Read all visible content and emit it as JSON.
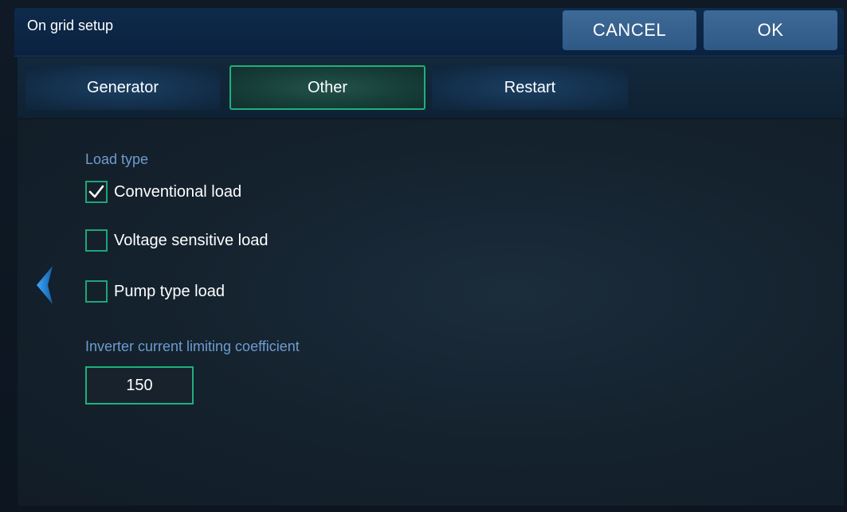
{
  "header": {
    "title": "On grid setup",
    "cancel_label": "CANCEL",
    "ok_label": "OK"
  },
  "tabs": [
    {
      "label": "Generator",
      "active": false
    },
    {
      "label": "Other",
      "active": true
    },
    {
      "label": "Restart",
      "active": false
    }
  ],
  "load_type": {
    "label": "Load type",
    "options": [
      {
        "label": "Conventional load",
        "checked": true
      },
      {
        "label": "Voltage sensitive load",
        "checked": false
      },
      {
        "label": "Pump type load",
        "checked": false
      }
    ]
  },
  "inverter": {
    "label": "Inverter current limiting coefficient",
    "value": "150"
  },
  "colors": {
    "accent_green": "#1fb07a",
    "label_blue": "#6e9ccf",
    "button_blue": "#3e6a98",
    "arrow_blue": "#2b8fe0"
  },
  "icons": {
    "back": "chevron-left-icon",
    "check": "checkmark-icon"
  }
}
